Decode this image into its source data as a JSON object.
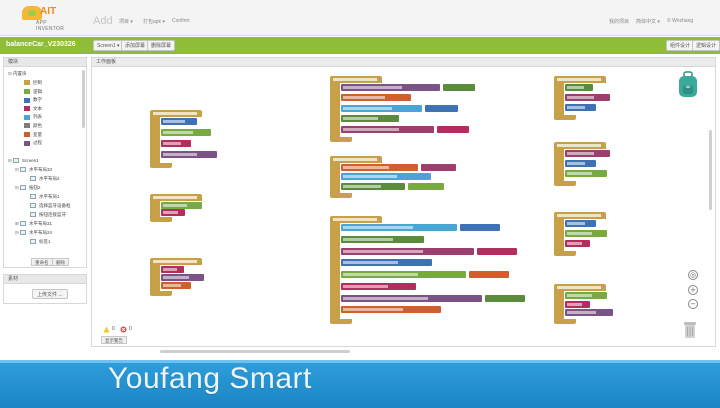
{
  "header": {
    "logo_title": "AIT",
    "logo_sub": "APP INVENTOR",
    "add_text": "Add",
    "menu": [
      "项目 ▾",
      "打包apk ▾",
      "Confirm"
    ],
    "right": [
      "我的项目",
      "简体中文 ▾",
      "© Wnzhang"
    ]
  },
  "project": {
    "name": "balanceCar_V230326",
    "screen_select": "Screen1 ▾",
    "add_screen": "添加屏幕",
    "remove_screen": "删除屏幕",
    "designer": "组件设计",
    "blocks": "逻辑设计"
  },
  "left_panel": {
    "title": "模块",
    "builtin": "内置块",
    "builtin_items": [
      {
        "label": "控制",
        "color": "#c8a047"
      },
      {
        "label": "逻辑",
        "color": "#77ab41"
      },
      {
        "label": "数学",
        "color": "#3f71b5"
      },
      {
        "label": "文本",
        "color": "#b32d5e"
      },
      {
        "label": "列表",
        "color": "#49a6d4"
      },
      {
        "label": "颜色",
        "color": "#7d7d7d"
      },
      {
        "label": "变量",
        "color": "#d05f2d"
      },
      {
        "label": "过程",
        "color": "#7c5385"
      }
    ],
    "components": [
      "Screen1",
      "水平布局33",
      "水平布局2",
      "按钮2",
      "水平布局1",
      "选择蓝牙设备框",
      "按钮连接蓝牙",
      "水平布局31",
      "水平布局24",
      "标签1"
    ],
    "rename_button": "重命名",
    "delete_button": "删除"
  },
  "media": {
    "title": "素材",
    "upload_button": "上传文件 ..."
  },
  "workspace": {
    "title": "工作面板",
    "warnings_count": "0",
    "errors_count": "0",
    "show_warnings_button": "显示警告"
  },
  "footer": {
    "watermark": "Youfang Smart"
  },
  "colors": {
    "project_bar": "#8fbd39",
    "control": "#c8a047",
    "band": "#2f9fdc"
  },
  "icons": [
    "backpack-icon",
    "zoom-center-icon",
    "zoom-in-icon",
    "zoom-out-icon",
    "trash-icon",
    "warning-icon",
    "error-icon"
  ]
}
